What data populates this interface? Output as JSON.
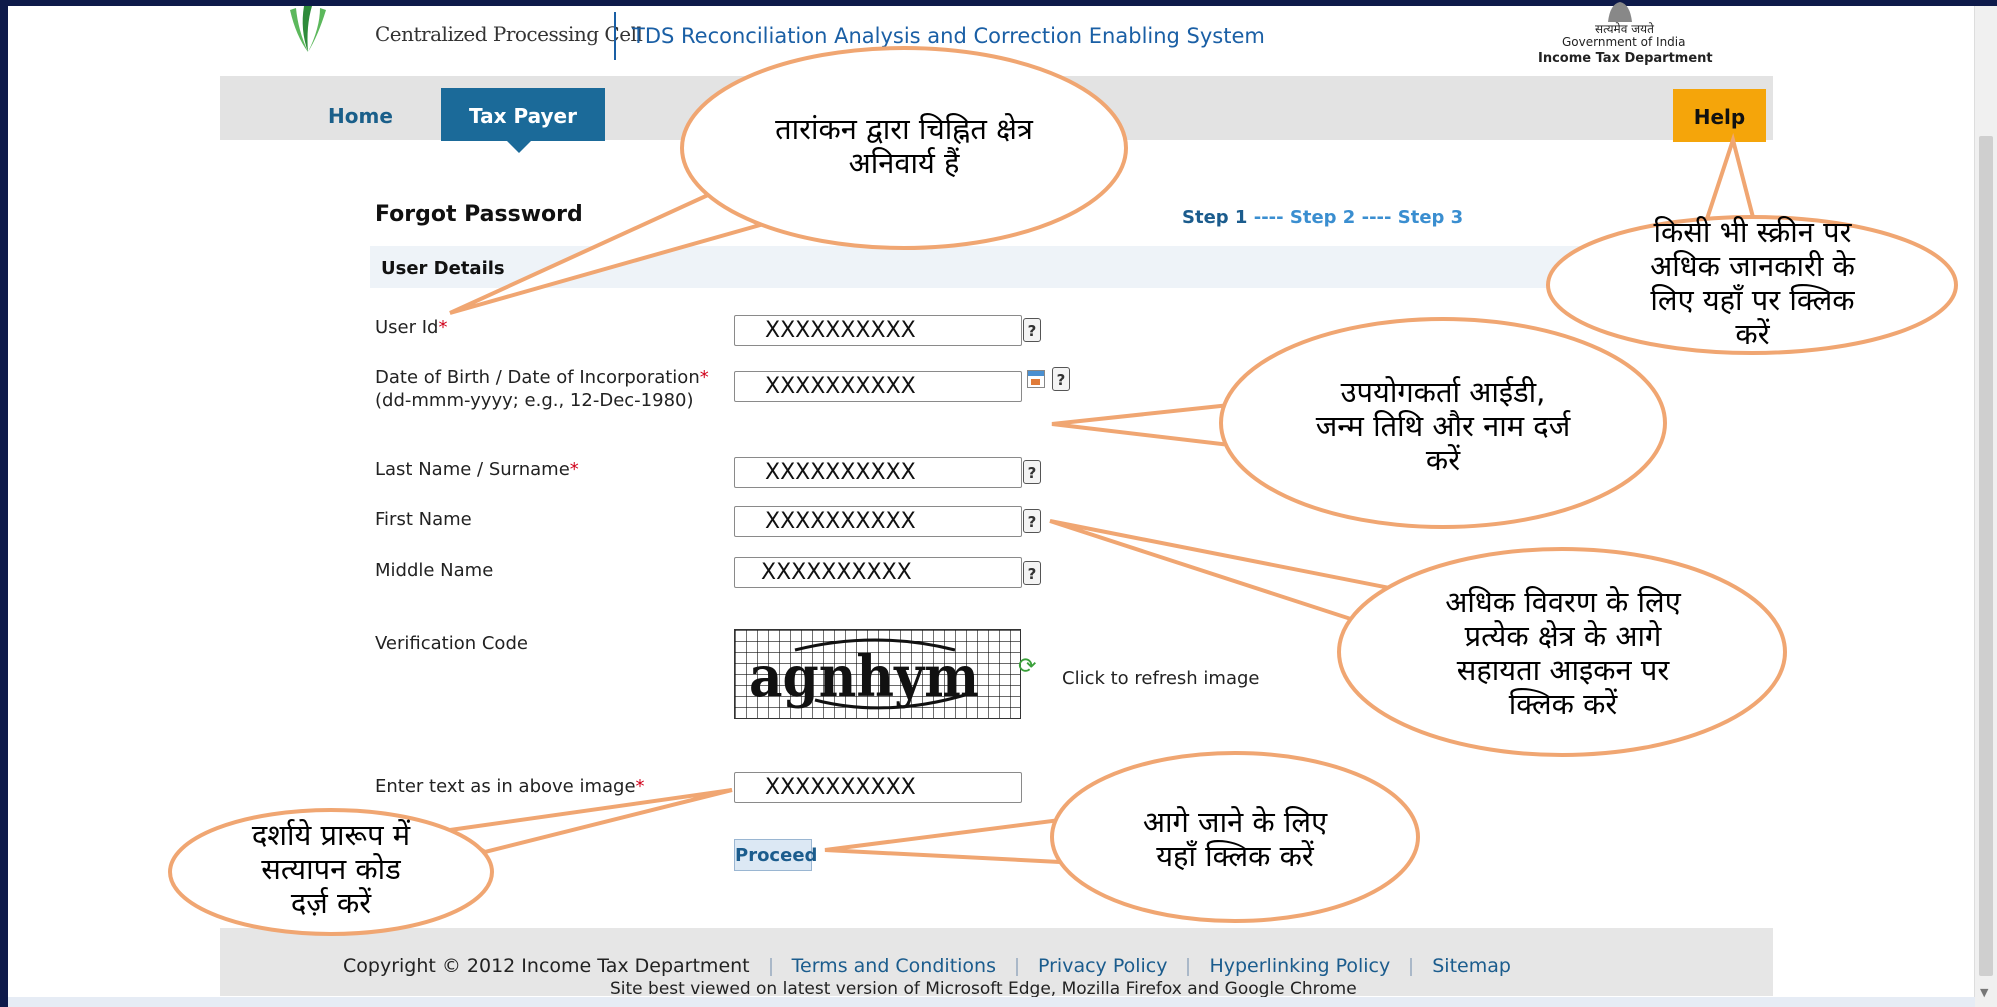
{
  "header": {
    "org_name": "Centralized Processing Cell",
    "app_title": "TDS Reconciliation Analysis and Correction Enabling System",
    "gov_hindi": "सत्यमेव जयते",
    "gov": "Government of India",
    "dept": "Income Tax Department"
  },
  "nav": {
    "home": "Home",
    "taxpayer": "Tax Payer",
    "help": "Help"
  },
  "page": {
    "title": "Forgot Password",
    "steps": {
      "step1": "Step 1",
      "sep": " ---- ",
      "step2": "Step 2",
      "step3": "Step 3"
    },
    "section": "User Details"
  },
  "form": {
    "user_id": {
      "label": "User Id",
      "value": "XXXXXXXXXX"
    },
    "dob": {
      "label": "Date of Birth / Date of Incorporation",
      "hint": "(dd-mmm-yyyy; e.g., 12-Dec-1980)",
      "value": "XXXXXXXXXX"
    },
    "last_name": {
      "label": "Last Name / Surname",
      "value": "XXXXXXXXXX"
    },
    "first_name": {
      "label": "First Name",
      "value": "XXXXXXXXXX"
    },
    "middle_name": {
      "label": "Middle Name",
      "value": "XXXXXXXXXX"
    },
    "verification": {
      "label": "Verification Code",
      "refresh_text": "Click to refresh image",
      "captcha_text": "agnhym"
    },
    "captcha_entry": {
      "label": "Enter text as in above image",
      "value": "XXXXXXXXXX"
    },
    "required_mark": "*",
    "help_glyph": "?",
    "proceed": "Proceed"
  },
  "footer": {
    "copyright": "Copyright © 2012 Income Tax Department",
    "links": [
      "Terms and Conditions",
      "Privacy Policy",
      "Hyperlinking Policy",
      "Sitemap"
    ],
    "note": "Site best viewed on latest version of Microsoft Edge, Mozilla Firefox and Google Chrome"
  },
  "annotations": {
    "mandatory": [
      "तारांकन द्वारा चिह्नित क्षेत्र",
      "अनिवार्य हैं"
    ],
    "help": [
      "किसी भी स्क्रीन पर",
      "अधिक जानकारी के",
      "लिए यहाँ पर क्लिक",
      "करें"
    ],
    "enter_details": [
      "उपयोगकर्ता आईडी,",
      "जन्म तिथि और नाम दर्ज",
      "करें"
    ],
    "help_icon": [
      "अधिक विवरण के लिए",
      "प्रत्येक क्षेत्र के आगे",
      "सहायता आइकन पर",
      "क्लिक करें"
    ],
    "captcha": [
      "दर्शाये प्रारूप में",
      "सत्यापन कोड",
      "दर्ज़ करें"
    ],
    "proceed": [
      "आगे जाने के लिए",
      "यहाँ क्लिक करें"
    ]
  },
  "colors": {
    "accent": "#1b6a99",
    "help": "#f5a50a",
    "callout": "#f0a672",
    "required": "#d0021b"
  }
}
